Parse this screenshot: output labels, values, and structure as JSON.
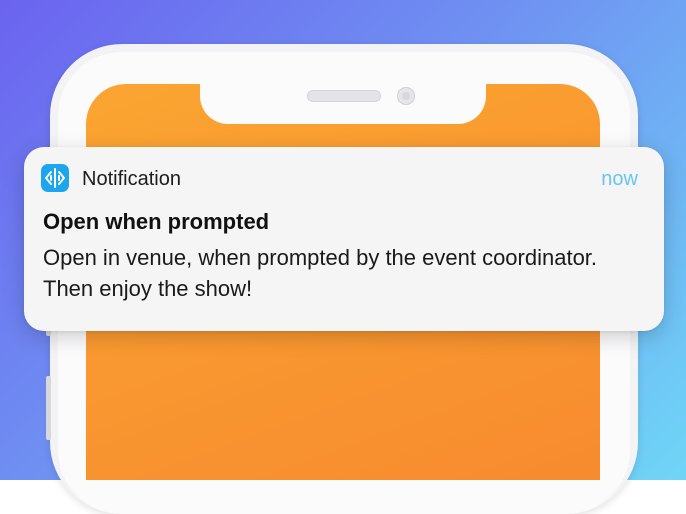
{
  "notification": {
    "app_icon": "waveform-icon",
    "app_name": "Notification",
    "time": "now",
    "title": "Open when prompted",
    "body": "Open in venue, when prompted by the event coordinator. Then enjoy the show!"
  },
  "colors": {
    "accent": "#1ba6ee",
    "time_text": "#6cc4ee",
    "screen_orange": "#f99a30"
  }
}
